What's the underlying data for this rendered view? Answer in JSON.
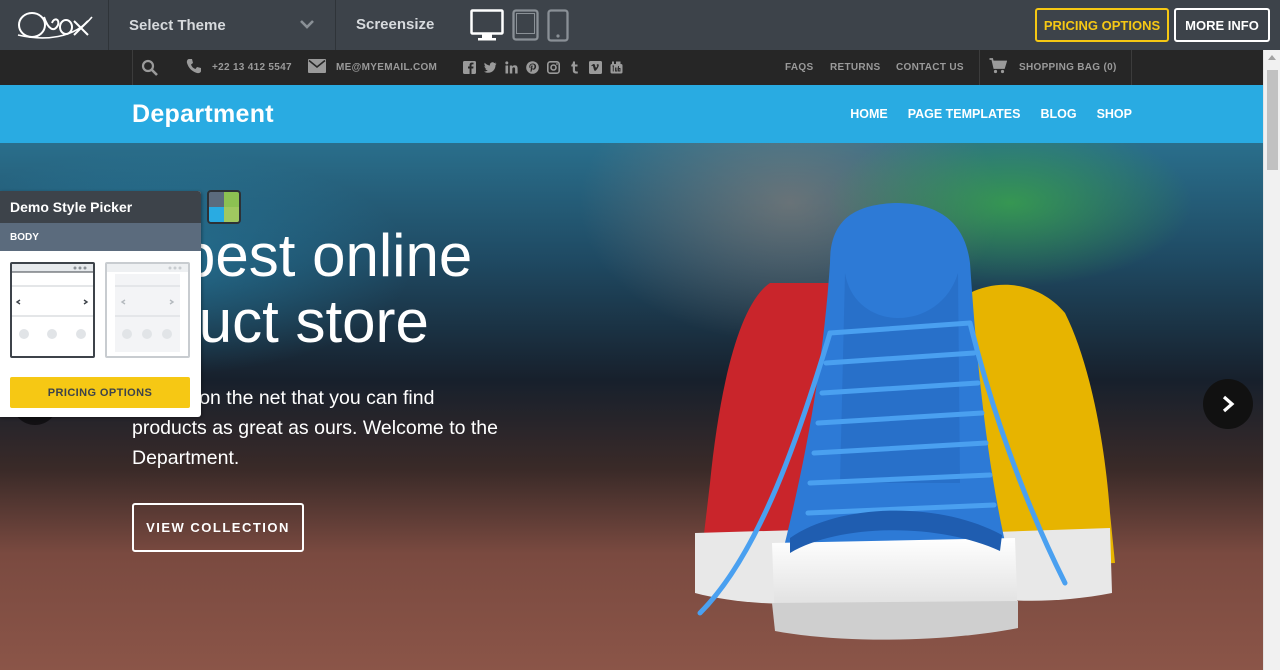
{
  "demo_bar": {
    "logo_text": "Obox",
    "theme_select_label": "Select Theme",
    "screensize_label": "Screensize",
    "devices": [
      "desktop",
      "tablet",
      "mobile"
    ],
    "pricing_label": "PRICING OPTIONS",
    "more_info_label": "MORE INFO",
    "colors": {
      "bar": "#3d434a",
      "accent": "#f6c814"
    }
  },
  "topbar": {
    "phone": "+22 13 412 5547",
    "email": "ME@MYEMAIL.COM",
    "social_icons": [
      "facebook-icon",
      "twitter-icon",
      "linkedin-icon",
      "pinterest-icon",
      "instagram-icon",
      "tumblr-icon",
      "vimeo-icon",
      "youtube-icon"
    ],
    "links": [
      "FAQS",
      "RETURNS",
      "CONTACT US"
    ],
    "cart_label": "SHOPPING BAG (0)"
  },
  "header": {
    "brand": "Department",
    "nav": [
      "HOME",
      "PAGE TEMPLATES",
      "BLOG",
      "SHOP"
    ],
    "color": "#29abe2"
  },
  "hero": {
    "headline_line1": "e best online",
    "headline_line2": "oduct store",
    "sub_line1": "y place on the net that you can find",
    "sub_line2": "products as great as ours. Welcome to the",
    "sub_line3": "Department.",
    "cta_label": "VIEW COLLECTION"
  },
  "style_picker": {
    "title": "Demo Style Picker",
    "section": "BODY",
    "pricing_label": "PRICING OPTIONS"
  }
}
